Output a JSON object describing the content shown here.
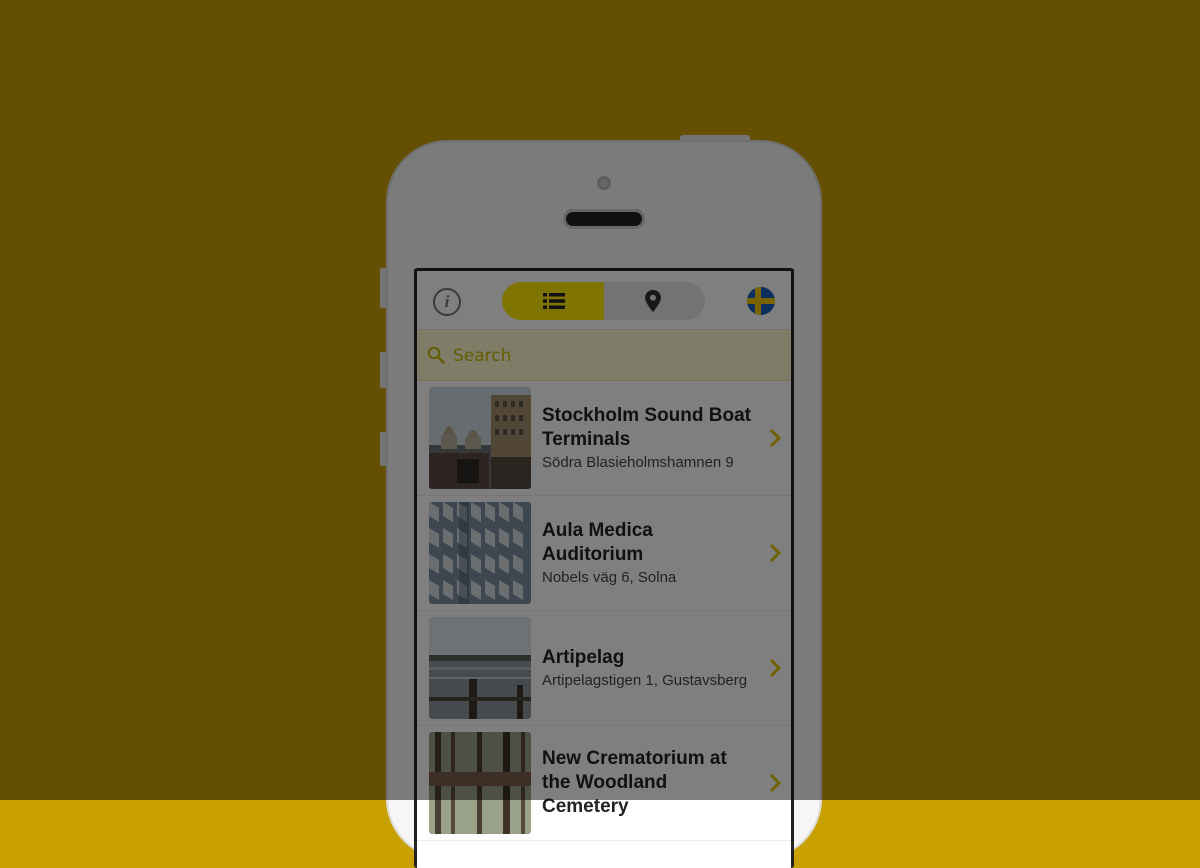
{
  "colors": {
    "background": "#c8a100",
    "accent": "#ffe800",
    "search_bg": "#fffbd0",
    "overlay": "rgba(0,0,0,0.5)"
  },
  "app": {
    "toolbar": {
      "info_icon": "info-icon",
      "view_toggle": [
        {
          "name": "list-view",
          "icon": "list-icon",
          "selected": true
        },
        {
          "name": "map-view",
          "icon": "map-pin-icon",
          "selected": false
        }
      ],
      "language_flag": "sweden-flag-icon"
    },
    "search": {
      "placeholder": "Search",
      "value": ""
    },
    "places": [
      {
        "title": "Stockholm Sound Boat Terminals",
        "address": "Södra Blasieholmshamnen 9",
        "image": "waterfront-buildings-photo"
      },
      {
        "title": "Aula Medica Auditorium",
        "address": "Nobels väg 6, Solna",
        "image": "faceted-facade-photo"
      },
      {
        "title": "Artipelag",
        "address": "Artipelagstigen 1, Gustavsberg",
        "image": "archipelago-water-photo"
      },
      {
        "title": "New Crematorium at the Woodland Cemetery",
        "address": "",
        "image": "woodland-forest-photo"
      }
    ]
  }
}
